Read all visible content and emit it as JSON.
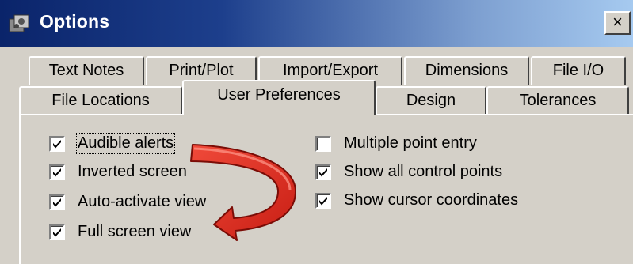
{
  "window": {
    "title": "Options",
    "close_symbol": "×",
    "icon": "options-app-icon"
  },
  "tabs": {
    "row1": [
      {
        "label": "Text Notes"
      },
      {
        "label": "Print/Plot"
      },
      {
        "label": "Import/Export"
      },
      {
        "label": "Dimensions"
      },
      {
        "label": "File I/O"
      }
    ],
    "row2": [
      {
        "label": "File Locations"
      },
      {
        "label": "User Preferences"
      },
      {
        "label": "Design"
      },
      {
        "label": "Tolerances"
      }
    ],
    "active": "User Preferences"
  },
  "options": {
    "left": [
      {
        "label": "Audible alerts",
        "checked": true
      },
      {
        "label": "Inverted screen",
        "checked": true
      },
      {
        "label": "Auto-activate view",
        "checked": true
      },
      {
        "label": "Full screen view",
        "checked": true
      }
    ],
    "right": [
      {
        "label": "Multiple point entry",
        "checked": false
      },
      {
        "label": "Show all control points",
        "checked": true
      },
      {
        "label": "Show cursor coordinates",
        "checked": true
      }
    ]
  },
  "annotation": {
    "icon": "curved-arrow-icon",
    "color": "#e8362a"
  },
  "colors": {
    "titlebar_start": "#0a246a",
    "titlebar_end": "#a6caf0",
    "face": "#d4d0c8"
  }
}
